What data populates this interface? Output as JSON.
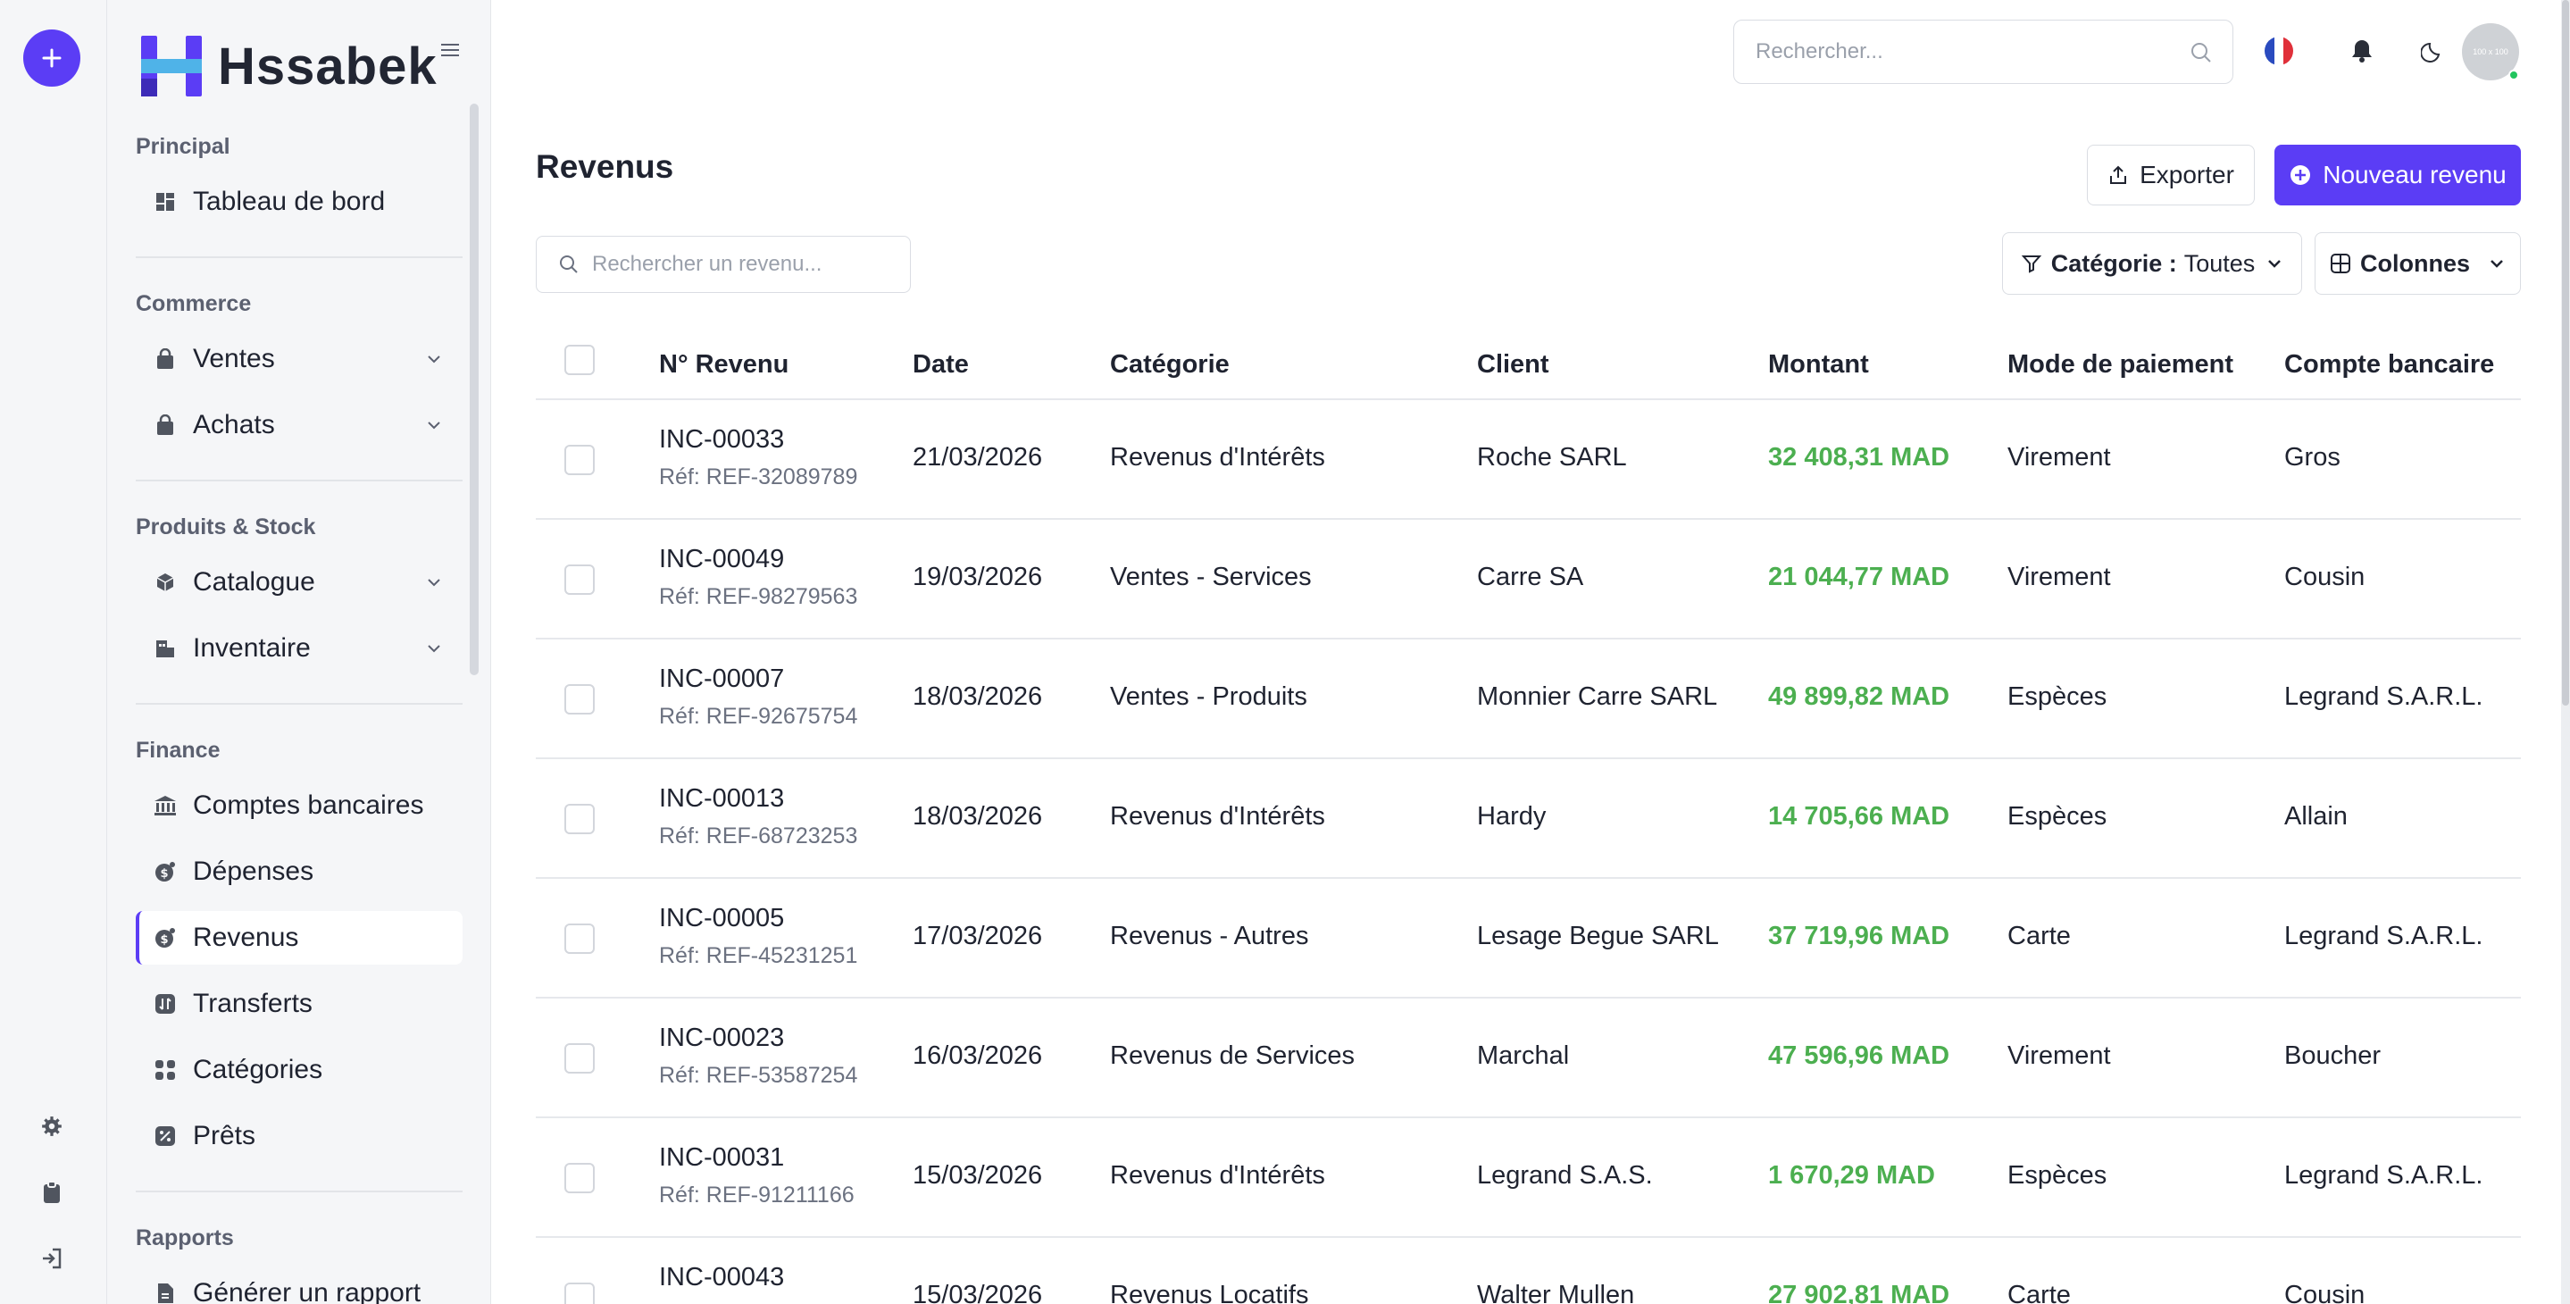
{
  "app": {
    "name": "Hssabek"
  },
  "sidebar": {
    "sections": [
      {
        "title": "Principal",
        "items": [
          {
            "label": "Tableau de bord",
            "icon": "dashboard-icon"
          }
        ]
      },
      {
        "title": "Commerce",
        "items": [
          {
            "label": "Ventes",
            "icon": "shopping-bag-icon",
            "expandable": true
          },
          {
            "label": "Achats",
            "icon": "shopping-bag-icon",
            "expandable": true
          }
        ]
      },
      {
        "title": "Produits & Stock",
        "items": [
          {
            "label": "Catalogue",
            "icon": "cube-icon",
            "expandable": true
          },
          {
            "label": "Inventaire",
            "icon": "warehouse-icon",
            "expandable": true
          }
        ]
      },
      {
        "title": "Finance",
        "items": [
          {
            "label": "Comptes bancaires",
            "icon": "bank-icon"
          },
          {
            "label": "Dépenses",
            "icon": "coin-icon"
          },
          {
            "label": "Revenus",
            "icon": "coin-icon",
            "active": true
          },
          {
            "label": "Transferts",
            "icon": "transfer-icon"
          },
          {
            "label": "Catégories",
            "icon": "grid-icon"
          },
          {
            "label": "Prêts",
            "icon": "percent-icon"
          }
        ]
      },
      {
        "title": "Rapports",
        "items": [
          {
            "label": "Générer un rapport",
            "icon": "file-icon"
          }
        ]
      }
    ]
  },
  "topbar": {
    "search_placeholder": "Rechercher...",
    "avatar_text": "100 x 100"
  },
  "page": {
    "title": "Revenus",
    "export_label": "Exporter",
    "new_label": "Nouveau revenu",
    "search_placeholder": "Rechercher un revenu...",
    "category_filter_label": "Catégorie :",
    "category_filter_value": "Toutes",
    "columns_label": "Colonnes"
  },
  "table": {
    "headers": {
      "id": "N° Revenu",
      "date": "Date",
      "category": "Catégorie",
      "client": "Client",
      "amount": "Montant",
      "payment_mode": "Mode de paiement",
      "bank_account": "Compte bancaire"
    },
    "rows": [
      {
        "id": "INC-00033",
        "ref": "Réf: REF-32089789",
        "date": "21/03/2026",
        "category": "Revenus d'Intérêts",
        "client": "Roche SARL",
        "amount": "32 408,31 MAD",
        "payment_mode": "Virement",
        "bank_account": "Gros"
      },
      {
        "id": "INC-00049",
        "ref": "Réf: REF-98279563",
        "date": "19/03/2026",
        "category": "Ventes - Services",
        "client": "Carre SA",
        "amount": "21 044,77 MAD",
        "payment_mode": "Virement",
        "bank_account": "Cousin"
      },
      {
        "id": "INC-00007",
        "ref": "Réf: REF-92675754",
        "date": "18/03/2026",
        "category": "Ventes - Produits",
        "client": "Monnier Carre SARL",
        "amount": "49 899,82 MAD",
        "payment_mode": "Espèces",
        "bank_account": "Legrand S.A.R.L."
      },
      {
        "id": "INC-00013",
        "ref": "Réf: REF-68723253",
        "date": "18/03/2026",
        "category": "Revenus d'Intérêts",
        "client": "Hardy",
        "amount": "14 705,66 MAD",
        "payment_mode": "Espèces",
        "bank_account": "Allain"
      },
      {
        "id": "INC-00005",
        "ref": "Réf: REF-45231251",
        "date": "17/03/2026",
        "category": "Revenus - Autres",
        "client": "Lesage Begue SARL",
        "amount": "37 719,96 MAD",
        "payment_mode": "Carte",
        "bank_account": "Legrand S.A.R.L."
      },
      {
        "id": "INC-00023",
        "ref": "Réf: REF-53587254",
        "date": "16/03/2026",
        "category": "Revenus de Services",
        "client": "Marchal",
        "amount": "47 596,96 MAD",
        "payment_mode": "Virement",
        "bank_account": "Boucher"
      },
      {
        "id": "INC-00031",
        "ref": "Réf: REF-91211166",
        "date": "15/03/2026",
        "category": "Revenus d'Intérêts",
        "client": "Legrand S.A.S.",
        "amount": "1 670,29 MAD",
        "payment_mode": "Espèces",
        "bank_account": "Legrand S.A.R.L."
      },
      {
        "id": "INC-00043",
        "ref": "",
        "date": "15/03/2026",
        "category": "Revenus Locatifs",
        "client": "Walter Mullen",
        "amount": "27 902,81 MAD",
        "payment_mode": "Carte",
        "bank_account": "Cousin"
      }
    ]
  },
  "colors": {
    "accent": "#5b3df5",
    "amount": "#4caf50",
    "sidebar_bg": "#f5f6f8"
  }
}
